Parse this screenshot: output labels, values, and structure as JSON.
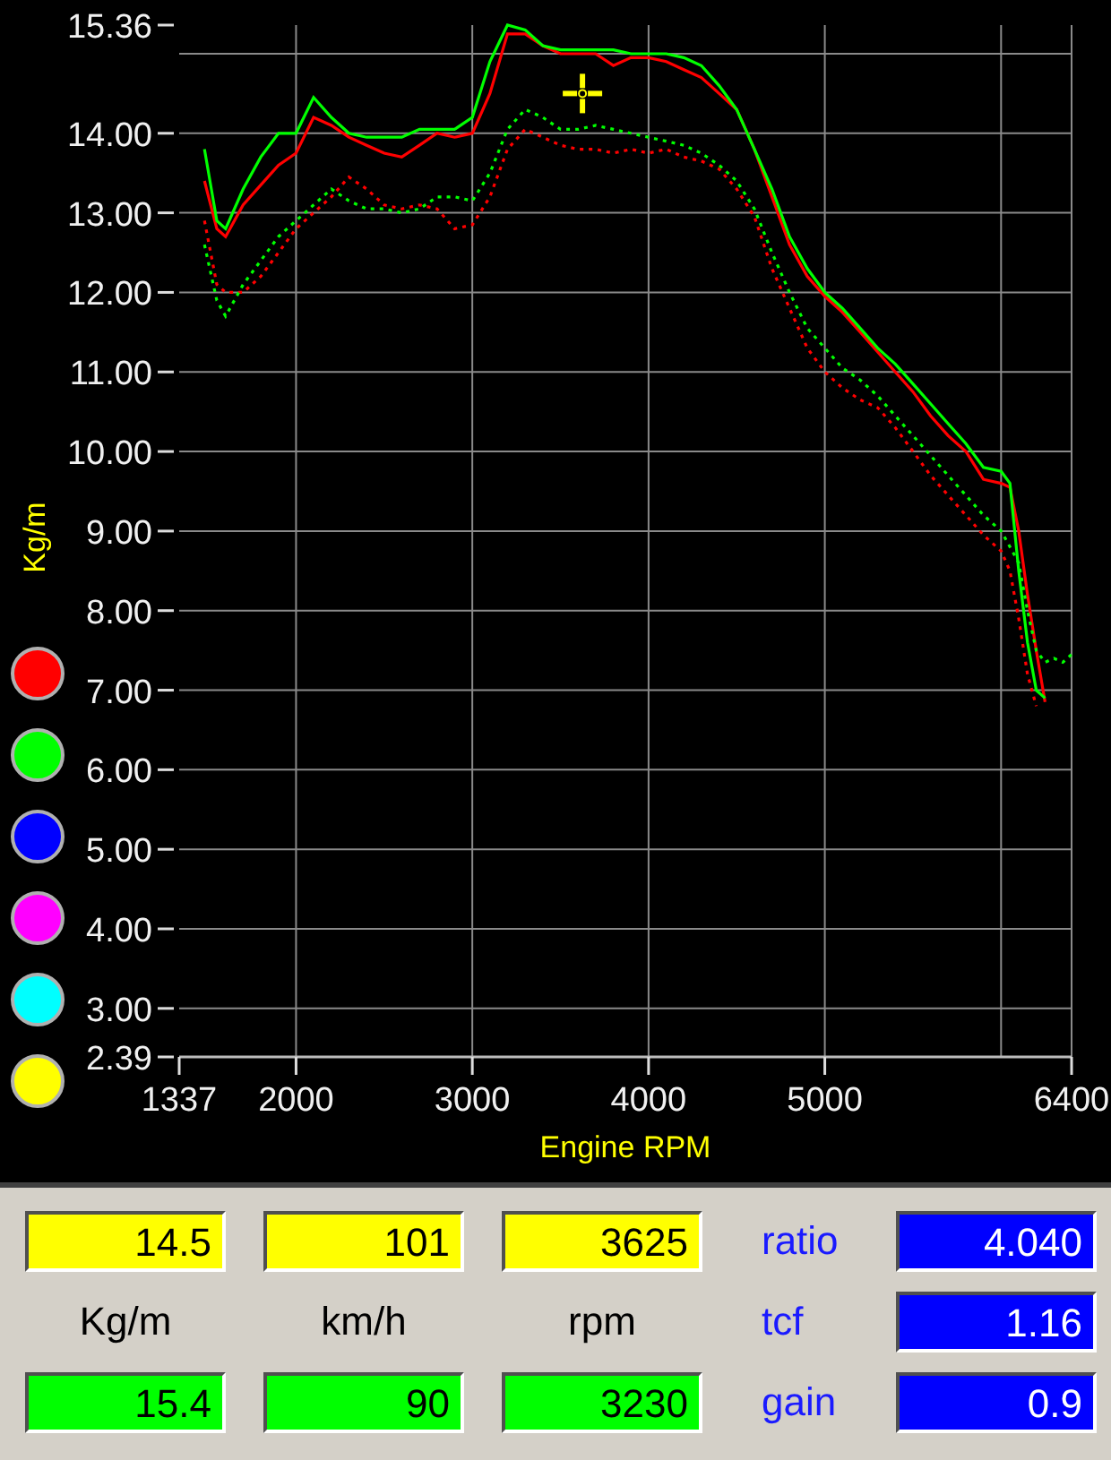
{
  "chart": {
    "chart_data": {
      "type": "line",
      "grid": true,
      "xlabel": "Engine RPM",
      "ylabel": "Kg/m",
      "xlim": [
        1337,
        6400
      ],
      "ylim": [
        2.39,
        15.36
      ],
      "xticks": [
        1337,
        2000,
        3000,
        4000,
        5000,
        6400
      ],
      "yticks": [
        {
          "value": 2.39,
          "label": "2.39"
        },
        {
          "value": 3,
          "label": "3.00"
        },
        {
          "value": 4,
          "label": "4.00"
        },
        {
          "value": 5,
          "label": "5.00"
        },
        {
          "value": 6,
          "label": "6.00"
        },
        {
          "value": 7,
          "label": "7.00"
        },
        {
          "value": 8,
          "label": "8.00"
        },
        {
          "value": 9,
          "label": "9.00"
        },
        {
          "value": 10,
          "label": "10.00"
        },
        {
          "value": 11,
          "label": "11.00"
        },
        {
          "value": 12,
          "label": "12.00"
        },
        {
          "value": 13,
          "label": "13.00"
        },
        {
          "value": 14,
          "label": "14.00"
        },
        {
          "value": 15.36,
          "label": "15.36"
        }
      ],
      "x": [
        1480,
        1550,
        1600,
        1700,
        1800,
        1900,
        2000,
        2100,
        2200,
        2300,
        2400,
        2500,
        2600,
        2700,
        2800,
        2900,
        3000,
        3100,
        3200,
        3300,
        3400,
        3500,
        3600,
        3700,
        3800,
        3900,
        4000,
        4100,
        4200,
        4300,
        4400,
        4500,
        4600,
        4700,
        4800,
        4900,
        5000,
        5100,
        5200,
        5300,
        5400,
        5500,
        5600,
        5700,
        5800,
        5900,
        6000,
        6050,
        6100,
        6150,
        6200,
        6250,
        6300,
        6350,
        6400
      ],
      "series": [
        {
          "color": "#ff0000",
          "line_style": "solid",
          "values": [
            13.4,
            12.8,
            12.7,
            13.1,
            13.35,
            13.6,
            13.75,
            14.2,
            14.1,
            13.95,
            13.85,
            13.75,
            13.7,
            13.85,
            14.0,
            13.95,
            14.0,
            14.5,
            15.25,
            15.25,
            15.1,
            15.0,
            15.0,
            15.0,
            14.85,
            14.95,
            14.95,
            14.9,
            14.8,
            14.7,
            14.5,
            14.3,
            13.8,
            13.2,
            12.6,
            12.2,
            11.95,
            11.75,
            11.5,
            11.25,
            11.0,
            10.75,
            10.45,
            10.2,
            10.0,
            9.65,
            9.6,
            9.55,
            9.0,
            8.2,
            7.5,
            6.85,
            null,
            null,
            null
          ]
        },
        {
          "color": "#00ff00",
          "line_style": "solid",
          "values": [
            13.8,
            12.9,
            12.8,
            13.3,
            13.7,
            14.0,
            14.0,
            14.45,
            14.2,
            14.0,
            13.95,
            13.95,
            13.95,
            14.05,
            14.05,
            14.05,
            14.2,
            14.9,
            15.36,
            15.3,
            15.1,
            15.05,
            15.05,
            15.05,
            15.05,
            15.0,
            15.0,
            15.0,
            14.95,
            14.85,
            14.6,
            14.3,
            13.8,
            13.3,
            12.7,
            12.3,
            12.0,
            11.8,
            11.55,
            11.3,
            11.1,
            10.85,
            10.6,
            10.35,
            10.1,
            9.8,
            9.75,
            9.6,
            8.5,
            7.6,
            7.0,
            6.9,
            null,
            null,
            null
          ]
        },
        {
          "color": "#ff0000",
          "line_style": "dotted",
          "values": [
            12.9,
            12.1,
            12.0,
            12.0,
            12.2,
            12.5,
            12.8,
            13.0,
            13.2,
            13.45,
            13.3,
            13.1,
            13.05,
            13.1,
            13.05,
            12.8,
            12.85,
            13.2,
            13.8,
            14.05,
            13.95,
            13.85,
            13.8,
            13.8,
            13.75,
            13.8,
            13.75,
            13.8,
            13.7,
            13.65,
            13.55,
            13.3,
            12.95,
            12.3,
            11.8,
            11.3,
            11.0,
            10.8,
            10.65,
            10.55,
            10.3,
            10.0,
            9.7,
            9.45,
            9.2,
            8.95,
            8.75,
            8.5,
            7.9,
            7.2,
            6.8,
            null,
            null,
            null,
            null
          ]
        },
        {
          "color": "#00ff00",
          "line_style": "dotted",
          "values": [
            12.6,
            11.9,
            11.7,
            12.1,
            12.4,
            12.7,
            12.9,
            13.1,
            13.3,
            13.15,
            13.05,
            13.05,
            13.0,
            13.05,
            13.2,
            13.2,
            13.15,
            13.5,
            14.05,
            14.3,
            14.2,
            14.05,
            14.05,
            14.1,
            14.05,
            14.0,
            13.95,
            13.9,
            13.85,
            13.75,
            13.6,
            13.4,
            13.05,
            12.5,
            12.0,
            11.55,
            11.3,
            11.05,
            10.9,
            10.7,
            10.45,
            10.2,
            9.95,
            9.7,
            9.45,
            9.2,
            9.0,
            8.8,
            8.6,
            8.0,
            7.5,
            7.35,
            7.4,
            7.35,
            7.45
          ]
        }
      ]
    },
    "legend": [
      {
        "color": "#ff0000"
      },
      {
        "color": "#00ff00"
      },
      {
        "color": "#0000ff"
      },
      {
        "color": "#ff00ff"
      },
      {
        "color": "#00ffff"
      },
      {
        "color": "#ffff00"
      }
    ]
  },
  "readouts": [
    {
      "cursor": "14.5",
      "unit": "Kg/m",
      "reference": "15.4"
    },
    {
      "cursor": "101",
      "unit": "km/h",
      "reference": "90"
    },
    {
      "cursor": "3625",
      "unit": "rpm",
      "reference": "3230"
    }
  ],
  "parameters": [
    {
      "label": "ratio",
      "value": "4.040"
    },
    {
      "label": "tcf",
      "value": "1.16"
    },
    {
      "label": "gain",
      "value": "0.9"
    }
  ]
}
